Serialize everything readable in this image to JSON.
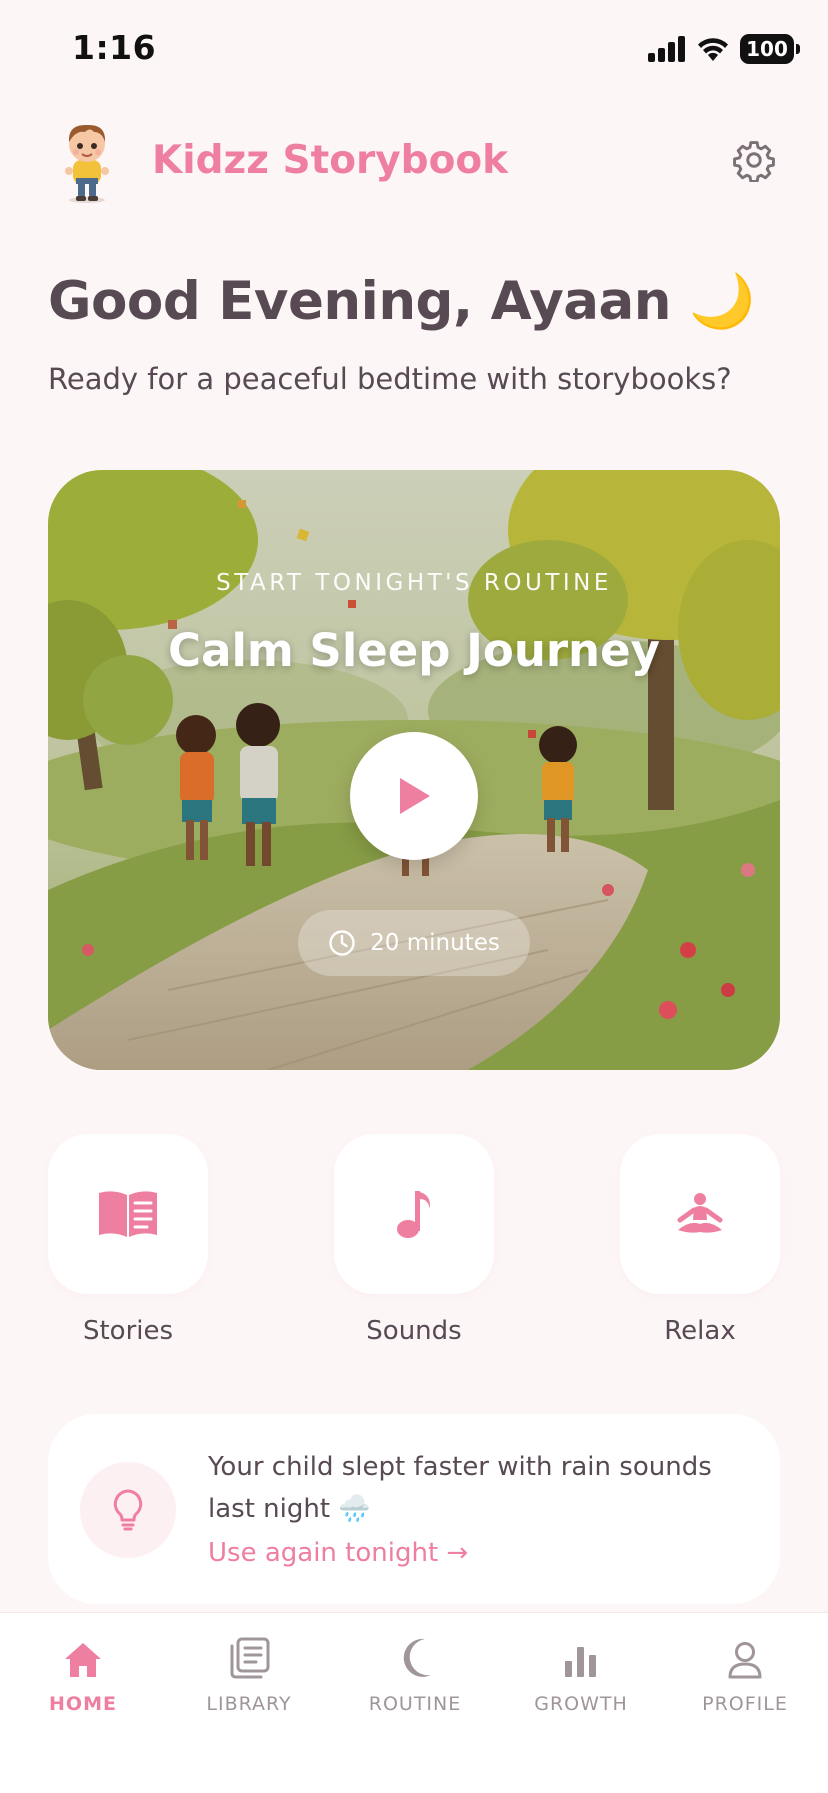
{
  "status_bar": {
    "time": "1:16",
    "battery": "100"
  },
  "header": {
    "app_title": "Kidzz Storybook",
    "avatar_icon": "boy-avatar-icon",
    "settings_icon": "gear-icon"
  },
  "greeting": {
    "title": "Good Evening, Ayaan",
    "emoji": "🌙",
    "subtitle": "Ready for a peaceful bedtime with storybooks?"
  },
  "hero": {
    "kicker": "START TONIGHT'S ROUTINE",
    "title": "Calm Sleep Journey",
    "duration": "20 minutes",
    "play_icon": "play-icon",
    "clock_icon": "clock-icon"
  },
  "quick_actions": [
    {
      "label": "Stories",
      "icon": "book-icon"
    },
    {
      "label": "Sounds",
      "icon": "music-note-icon"
    },
    {
      "label": "Relax",
      "icon": "meditation-icon"
    }
  ],
  "tip": {
    "text": "Your child slept faster with rain sounds last night 🌧️",
    "link": "Use again tonight →",
    "icon": "lightbulb-icon"
  },
  "tabs": [
    {
      "label": "HOME",
      "icon": "home-icon",
      "active": true
    },
    {
      "label": "LIBRARY",
      "icon": "library-icon",
      "active": false
    },
    {
      "label": "ROUTINE",
      "icon": "moon-icon",
      "active": false
    },
    {
      "label": "GROWTH",
      "icon": "bar-chart-icon",
      "active": false
    },
    {
      "label": "PROFILE",
      "icon": "user-icon",
      "active": false
    }
  ],
  "colors": {
    "accent": "#ee7fa0",
    "background": "#fdf6f6",
    "text": "#574a53",
    "muted": "#9f959b"
  }
}
